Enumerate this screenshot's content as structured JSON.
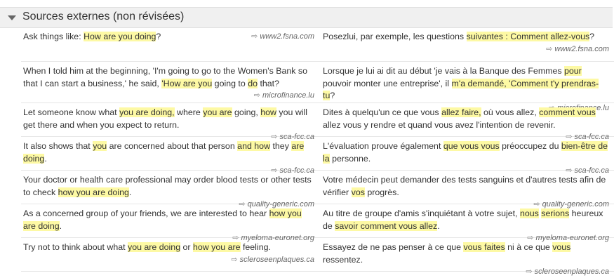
{
  "section_title": "Sources externes (non révisées)",
  "rows": [
    {
      "en": [
        "Ask things like: ",
        {
          "h": "How are you doing"
        },
        "?"
      ],
      "en_src": "www2.fsna.com",
      "fr": [
        "Posezlui, par exemple, les questions ",
        {
          "h": "suivantes : Comment allez-vous"
        },
        "?"
      ],
      "fr_src": "www2.fsna.com"
    },
    {
      "en": [
        "When I told him at the beginning, 'I'm going to go to the Women's Bank so that I can start a business,' he said, ",
        {
          "h": "'How are you"
        },
        " going to ",
        {
          "h": "do"
        },
        " that?"
      ],
      "en_src": "microfinance.lu",
      "fr": [
        "Lorsque je lui ai dit au début 'je vais à la Banque des Femmes ",
        {
          "h": "pour"
        },
        " pouvoir monter une entreprise', il ",
        {
          "h": "m'a demandé, 'Comment t'y prendras-tu"
        },
        "?"
      ],
      "fr_src": "microfinance.lu"
    },
    {
      "en": [
        "Let someone know what ",
        {
          "h": "you are doing,"
        },
        " where ",
        {
          "h": "you are"
        },
        " going, ",
        {
          "h": "how"
        },
        " you will get there and when you expect to return."
      ],
      "en_src": "sca-fcc.ca",
      "fr": [
        "Dites à quelqu'un ce que vous ",
        {
          "h": "allez faire,"
        },
        " où vous allez, ",
        {
          "h": "comment vous"
        },
        " allez vous y rendre et quand vous avez l'intention de revenir."
      ],
      "fr_src": "sca-fcc.ca"
    },
    {
      "en": [
        "It also shows that ",
        {
          "h": "you"
        },
        " are concerned about that person ",
        {
          "h": "and how"
        },
        " they ",
        {
          "h": "are doing"
        },
        "."
      ],
      "en_src": "sca-fcc.ca",
      "fr": [
        "L'évaluation prouve également ",
        {
          "h": "que vous vous"
        },
        " préoccupez du ",
        {
          "h": "bien-être de la"
        },
        " personne."
      ],
      "fr_src": "sca-fcc.ca"
    },
    {
      "en": [
        "Your doctor or health care professional may order blood tests or other tests to check ",
        {
          "h": "how you are doing"
        },
        "."
      ],
      "en_src": "quality-generic.com",
      "fr": [
        "Votre médecin peut demander des tests sanguins et d'autres tests afin de vérifier ",
        {
          "h": "vos"
        },
        " progrès."
      ],
      "fr_src": "quality-generic.com"
    },
    {
      "en": [
        "As a concerned group of your friends, we are interested to hear ",
        {
          "h": "how you are doing"
        },
        "."
      ],
      "en_src": "myeloma-euronet.org",
      "fr": [
        "Au titre de groupe d'amis s'inquiétant à votre sujet, ",
        {
          "h": "nous"
        },
        " ",
        {
          "h": "serions"
        },
        " heureux de ",
        {
          "h": "savoir comment vous allez"
        },
        "."
      ],
      "fr_src": "myeloma-euronet.org"
    },
    {
      "en": [
        "Try not to think about what ",
        {
          "h": "you are doing"
        },
        " or ",
        {
          "h": "how you are"
        },
        " feeling."
      ],
      "en_src": "scleroseenplaques.ca",
      "fr": [
        "Essayez de ne pas penser à ce que ",
        {
          "h": "vous faites"
        },
        " ni à ce que ",
        {
          "h": "vous"
        },
        " ressentez."
      ],
      "fr_src": "scleroseenplaques.ca"
    }
  ]
}
